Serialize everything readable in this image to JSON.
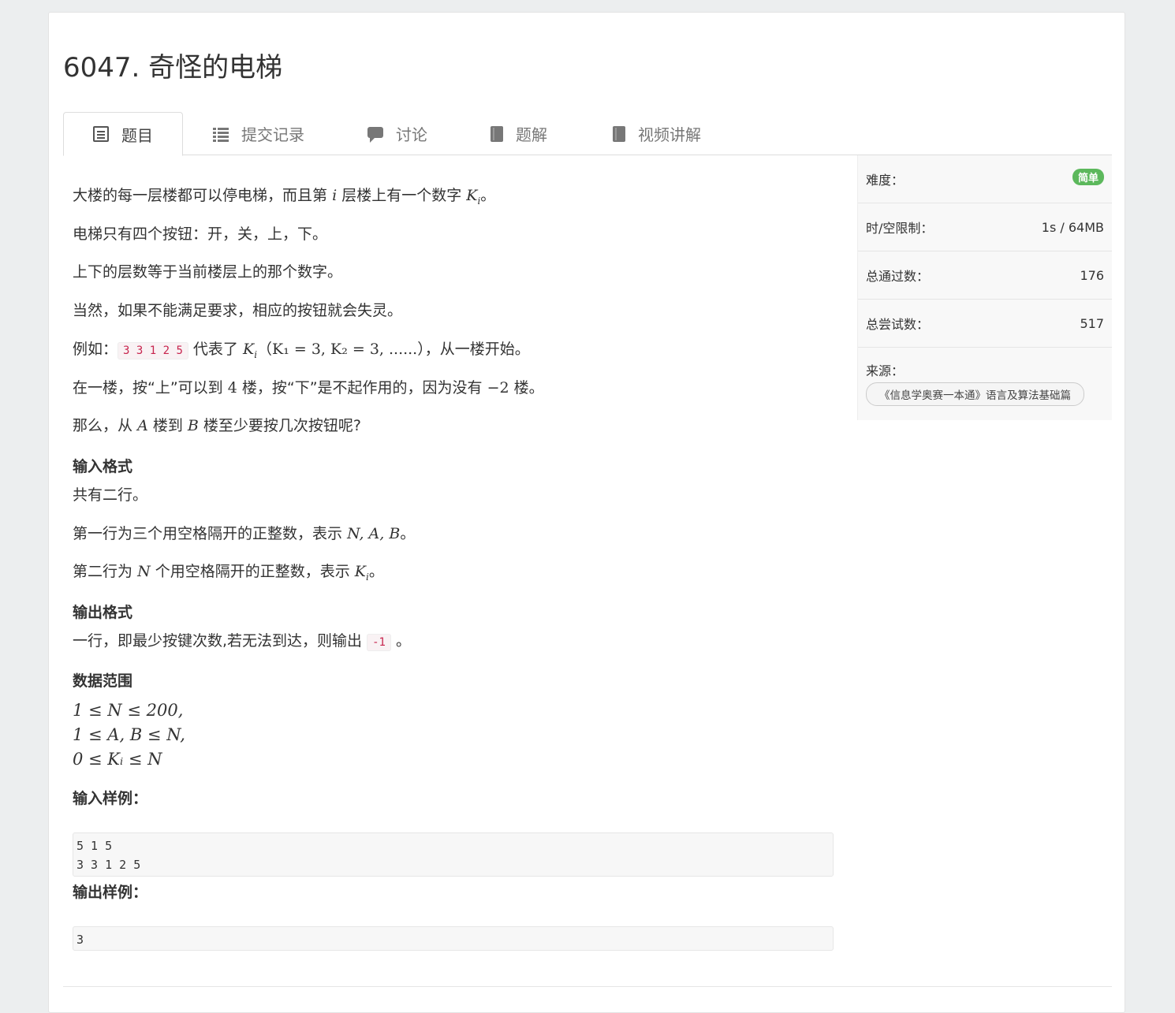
{
  "problem": {
    "title": "6047. 奇怪的电梯"
  },
  "tabs": [
    {
      "label": "题目",
      "icon": "document-list-icon"
    },
    {
      "label": "提交记录",
      "icon": "list-icon"
    },
    {
      "label": "讨论",
      "icon": "chat-icon"
    },
    {
      "label": "题解",
      "icon": "book-icon"
    },
    {
      "label": "视频讲解",
      "icon": "book-icon"
    }
  ],
  "statement": {
    "p1_a": "大楼的每一层楼都可以停电梯，而且第",
    "p1_i": "i",
    "p1_b": "层楼上有一个数字",
    "p1_k": "K",
    "p1_sub": "i",
    "p1_end": "。",
    "p2": "电梯只有四个按钮：开，关，上，下。",
    "p3": "上下的层数等于当前楼层上的那个数字。",
    "p4": "当然，如果不能满足要求，相应的按钮就会失灵。",
    "p5_a": "例如：",
    "p5_code": "3 3 1 2 5",
    "p5_b": "代表了",
    "p5_k": "K",
    "p5_sub": "i",
    "p5_math": "（K₁ = 3, K₂ = 3, ......）",
    "p5_c": "，从一楼开始。",
    "p6_a": "在一楼，按“上”可以到",
    "p6_n": "4",
    "p6_b": "楼，按“下”是不起作用的，因为没有",
    "p6_m": "−2",
    "p6_c": "楼。",
    "p7_a": "那么，从",
    "p7_A": "A",
    "p7_b": "楼到",
    "p7_B": "B",
    "p7_c": "楼至少要按几次按钮呢?"
  },
  "input_format": {
    "heading": "输入格式",
    "l1": "共有二行。",
    "l2_a": "第一行为三个用空格隔开的正整数，表示",
    "l2_m": "N, A, B",
    "l2_end": "。",
    "l3_a": "第二行为",
    "l3_n": "N",
    "l3_b": "个用空格隔开的正整数，表示",
    "l3_k": "K",
    "l3_sub": "i",
    "l3_end": "。"
  },
  "output_format": {
    "heading": "输出格式",
    "l1_a": "一行，即最少按键次数,若无法到达，则输出",
    "l1_code": "-1",
    "l1_end": "。"
  },
  "range": {
    "heading": "数据范围",
    "r1": "1 ≤ N ≤ 200,",
    "r2": "1 ≤ A, B ≤ N,",
    "r3": "0 ≤ Kᵢ ≤ N"
  },
  "sample_input": {
    "heading": "输入样例：",
    "text": "5 1 5\n3 3 1 2 5"
  },
  "sample_output": {
    "heading": "输出样例：",
    "text": "3"
  },
  "sidebar": {
    "difficulty_label": "难度：",
    "difficulty_value": "简单",
    "limit_label": "时/空限制：",
    "limit_value": "1s / 64MB",
    "passed_label": "总通过数：",
    "passed_value": "176",
    "tried_label": "总尝试数：",
    "tried_value": "517",
    "source_label": "来源：",
    "source_value": "《信息学奥赛一本通》语言及算法基础篇"
  },
  "colors": {
    "badge": "#5cb85c",
    "code": "#c7254e"
  }
}
